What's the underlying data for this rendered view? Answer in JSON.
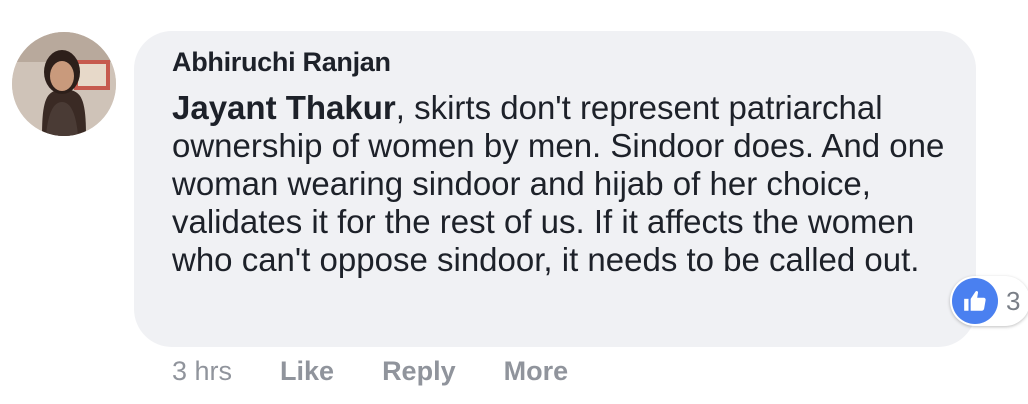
{
  "comment": {
    "author": "Abhiruchi Ranjan",
    "mention": "Jayant Thakur",
    "text": ", skirts don't represent patriarchal ownership of women by men. Sindoor does. And one woman wearing sindoor and hijab of her choice, validates it for the rest of us. If it affects the women who can't oppose sindoor, it needs to be called out.",
    "avatar_icon": "profile-photo",
    "reaction": {
      "icon": "thumbs-up-icon",
      "count": "3",
      "color": "#4a80f0"
    },
    "meta": {
      "time": "3 hrs",
      "like_label": "Like",
      "reply_label": "Reply",
      "more_label": "More"
    }
  },
  "colors": {
    "bubble": "#f0f1f4",
    "text": "#1d2129",
    "muted": "#90949c"
  }
}
